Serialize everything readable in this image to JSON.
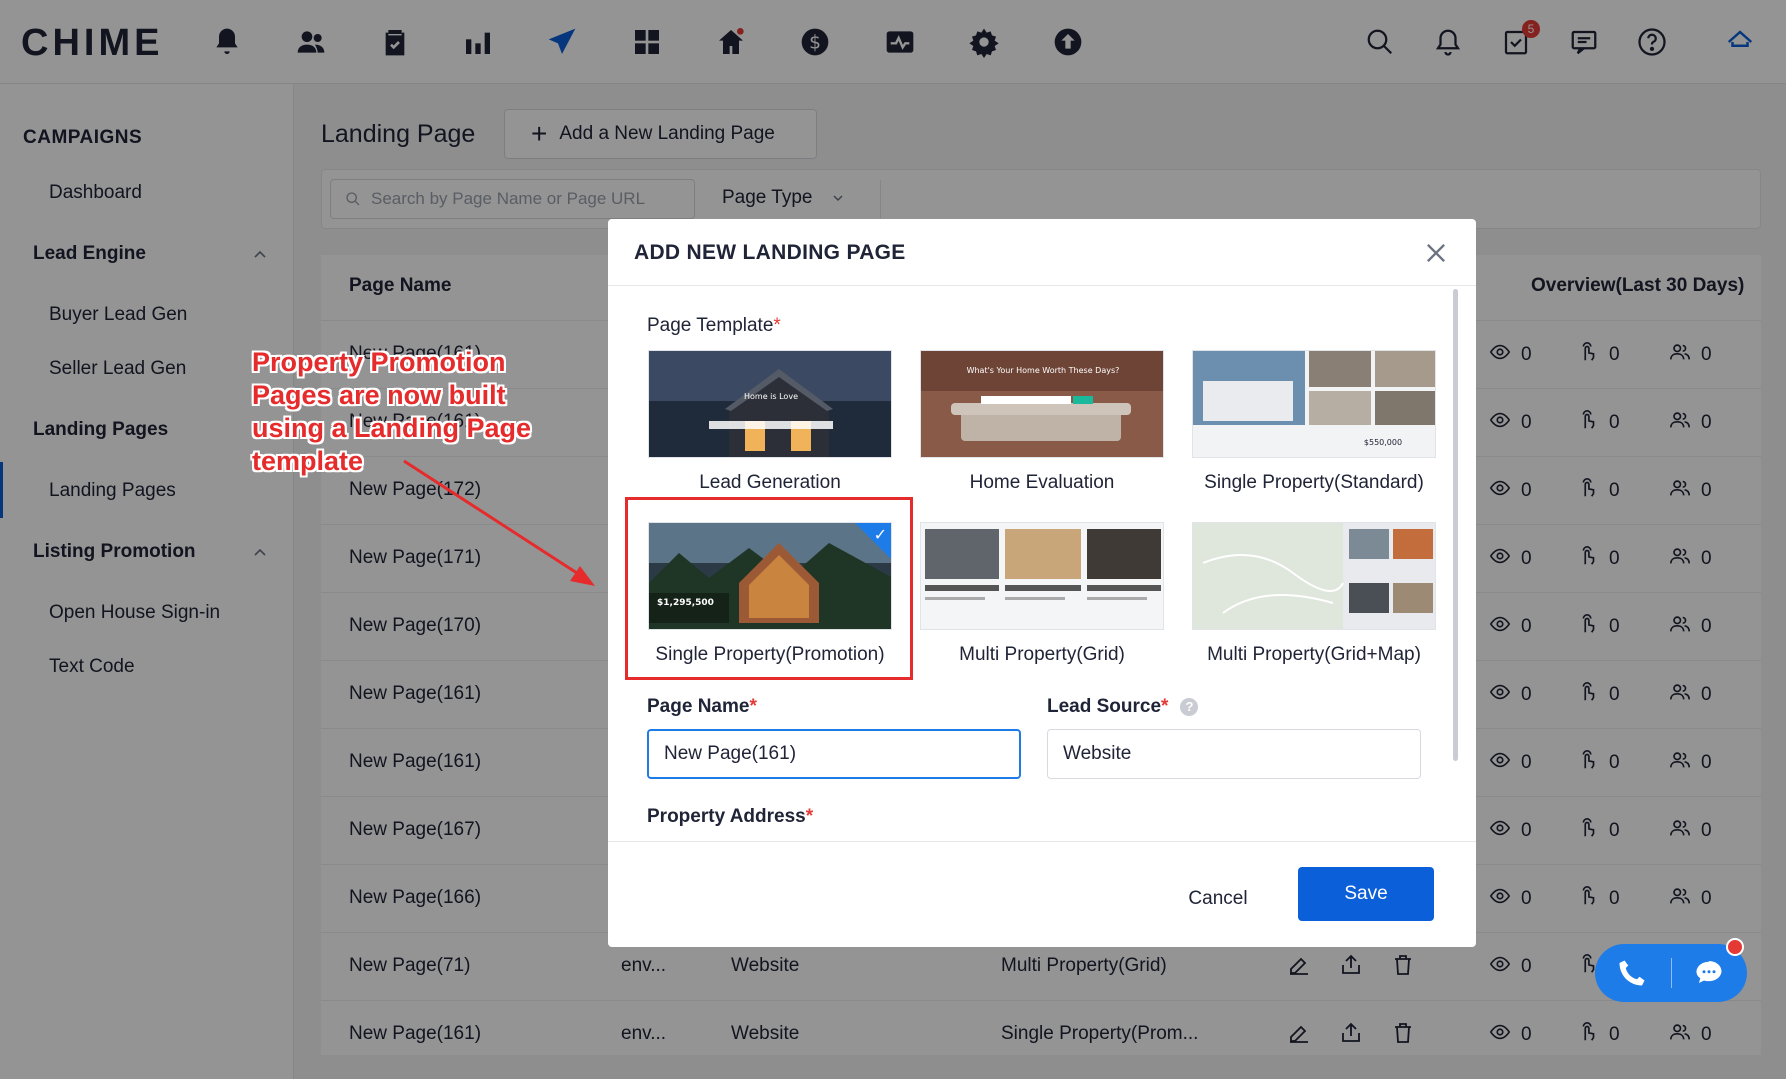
{
  "brand": {
    "logo_text": "CHIME",
    "accent": "#0b5fd9"
  },
  "topbar": {
    "nav_icons": [
      "bell-icon",
      "people-icon",
      "clipboard-check-icon",
      "bar-chart-icon",
      "paper-plane-icon",
      "grid-icon",
      "home-icon",
      "dollar-icon",
      "activity-icon",
      "gear-icon",
      "upload-icon"
    ],
    "right_icons": [
      "search-icon",
      "notification-icon",
      "tasks-icon",
      "message-icon",
      "help-icon",
      "home-outline-icon"
    ],
    "tasks_badge": "5"
  },
  "sidebar": {
    "title": "CAMPAIGNS",
    "dashboard": "Dashboard",
    "lead_engine": "Lead Engine",
    "buyer_lead_gen": "Buyer Lead Gen",
    "seller_lead_gen": "Seller Lead Gen",
    "landing_pages_group": "Landing Pages",
    "landing_pages_item": "Landing Pages",
    "listing_promotion": "Listing Promotion",
    "open_house": "Open House Sign-in",
    "text_code": "Text Code"
  },
  "main": {
    "title": "Landing Page",
    "add_button": "Add a New Landing Page",
    "search_placeholder": "Search by Page Name or Page URL",
    "page_type": "Page Type",
    "col_page_name": "Page Name",
    "col_overview": "Overview(Last 30 Days)",
    "rows": [
      {
        "name": "New Page(161)",
        "col2": "",
        "col3": "",
        "col4": "",
        "views": "0",
        "clicks": "0",
        "leads": "0"
      },
      {
        "name": "New Page(161)",
        "col2": "",
        "col3": "",
        "col4": "",
        "views": "0",
        "clicks": "0",
        "leads": "0"
      },
      {
        "name": "New Page(172)",
        "col2": "",
        "col3": "",
        "col4": "",
        "views": "0",
        "clicks": "0",
        "leads": "0"
      },
      {
        "name": "New Page(171)",
        "col2": "",
        "col3": "",
        "col4": "",
        "views": "0",
        "clicks": "0",
        "leads": "0"
      },
      {
        "name": "New Page(170)",
        "col2": "",
        "col3": "",
        "col4": "",
        "views": "0",
        "clicks": "0",
        "leads": "0"
      },
      {
        "name": "New Page(161)",
        "col2": "",
        "col3": "",
        "col4": "",
        "views": "0",
        "clicks": "0",
        "leads": "0"
      },
      {
        "name": "New Page(161)",
        "col2": "",
        "col3": "",
        "col4": "",
        "views": "0",
        "clicks": "0",
        "leads": "0"
      },
      {
        "name": "New Page(167)",
        "col2": "",
        "col3": "",
        "col4": "",
        "views": "0",
        "clicks": "0",
        "leads": "0"
      },
      {
        "name": "New Page(166)",
        "col2": "",
        "col3": "",
        "col4": "",
        "views": "0",
        "clicks": "0",
        "leads": "0"
      },
      {
        "name": "New Page(71)",
        "col2": "env...",
        "col3": "Website",
        "col4": "Multi Property(Grid)",
        "views": "0",
        "clicks": "0",
        "leads": "0"
      },
      {
        "name": "New Page(161)",
        "col2": "env...",
        "col3": "Website",
        "col4": "Single Property(Prom...",
        "views": "0",
        "clicks": "0",
        "leads": "0"
      }
    ]
  },
  "modal": {
    "title": "ADD NEW LANDING PAGE",
    "page_template_label": "Page Template",
    "templates": [
      {
        "caption": "Lead Generation",
        "thumb_text": "Home is Love"
      },
      {
        "caption": "Home Evaluation",
        "thumb_text": "What's Your Home Worth These Days?"
      },
      {
        "caption": "Single Property(Standard)",
        "thumb_text": "$550,000"
      },
      {
        "caption": "Single Property(Promotion)",
        "thumb_text": "$1,295,500"
      },
      {
        "caption": "Multi Property(Grid)",
        "thumb_text": ""
      },
      {
        "caption": "Multi Property(Grid+Map)",
        "thumb_text": ""
      }
    ],
    "page_name_label": "Page Name",
    "page_name_value": "New Page(161)",
    "lead_source_label": "Lead Source",
    "lead_source_value": "Website",
    "property_address_label": "Property Address",
    "cancel": "Cancel",
    "save": "Save"
  },
  "annotation": {
    "text": "Property Promotion\nPages are now built\nusing a Landing Page\ntemplate",
    "color": "#e52b2b"
  }
}
